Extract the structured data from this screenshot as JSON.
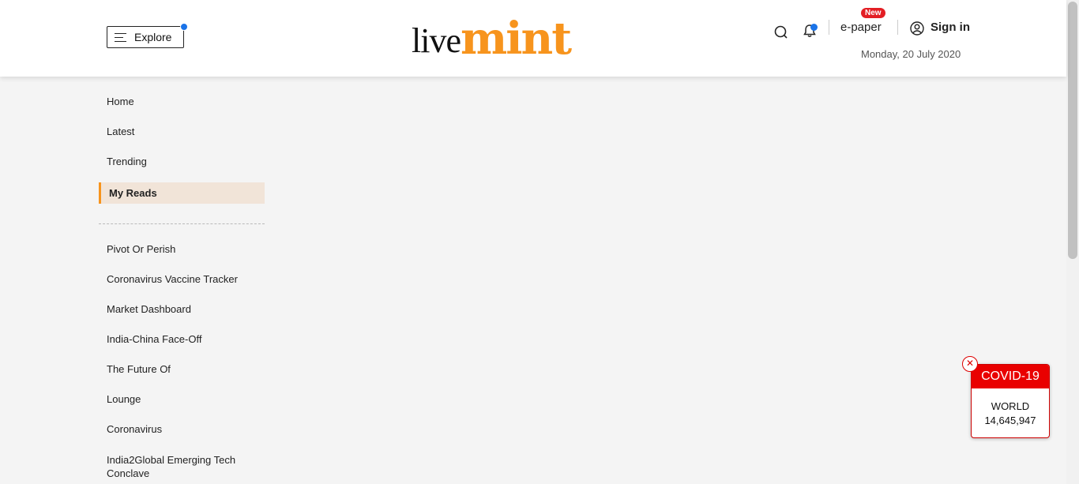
{
  "header": {
    "explore_label": "Explore",
    "logo_live": "live",
    "logo_mint": "mint",
    "epaper_label": "e-paper",
    "new_badge": "New",
    "signin_label": "Sign in",
    "date": "Monday, 20 July 2020"
  },
  "sidebar": {
    "primary": [
      "Home",
      "Latest",
      "Trending",
      "My Reads"
    ],
    "active": "My Reads",
    "sections": [
      "Pivot Or Perish",
      "Coronavirus Vaccine Tracker",
      "Market Dashboard",
      "India-China Face-Off",
      "The Future Of",
      "Lounge",
      "Coronavirus",
      "India2Global Emerging Tech Conclave"
    ]
  },
  "covid_widget": {
    "title": "COVID-19",
    "label": "WORLD",
    "value": "14,645,947"
  },
  "colors": {
    "accent": "#f7941d",
    "covid_red": "#e90000",
    "notification_dot": "#1a73e8"
  }
}
